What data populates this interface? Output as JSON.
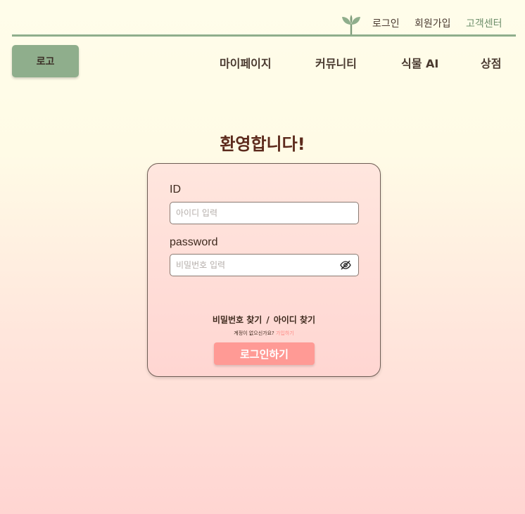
{
  "header": {
    "links": [
      {
        "label": "로그인"
      },
      {
        "label": "회원가입"
      },
      {
        "label": "고객센터"
      }
    ],
    "logo_label": "로고",
    "nav": [
      {
        "label": "마이페이지"
      },
      {
        "label": "커뮤니티"
      },
      {
        "label": "식물 AI"
      },
      {
        "label": "상점"
      }
    ],
    "icon": "sprout-icon"
  },
  "main": {
    "title": "환영합니다!"
  },
  "form": {
    "id_label": "ID",
    "id_placeholder": "아이디 입력",
    "password_label": "password",
    "password_placeholder": "비밀번호 입력",
    "find_password": "비밀번호 찾기",
    "separator": "/",
    "find_id": "아이디 찾기",
    "no_account": "계정이 없으신가요?",
    "signup_link": "가입하기",
    "submit": "로그인하기"
  },
  "colors": {
    "accent_green": "#8fae8c",
    "button_pink": "#ff9a95",
    "title_brown": "#5c2a1c"
  }
}
